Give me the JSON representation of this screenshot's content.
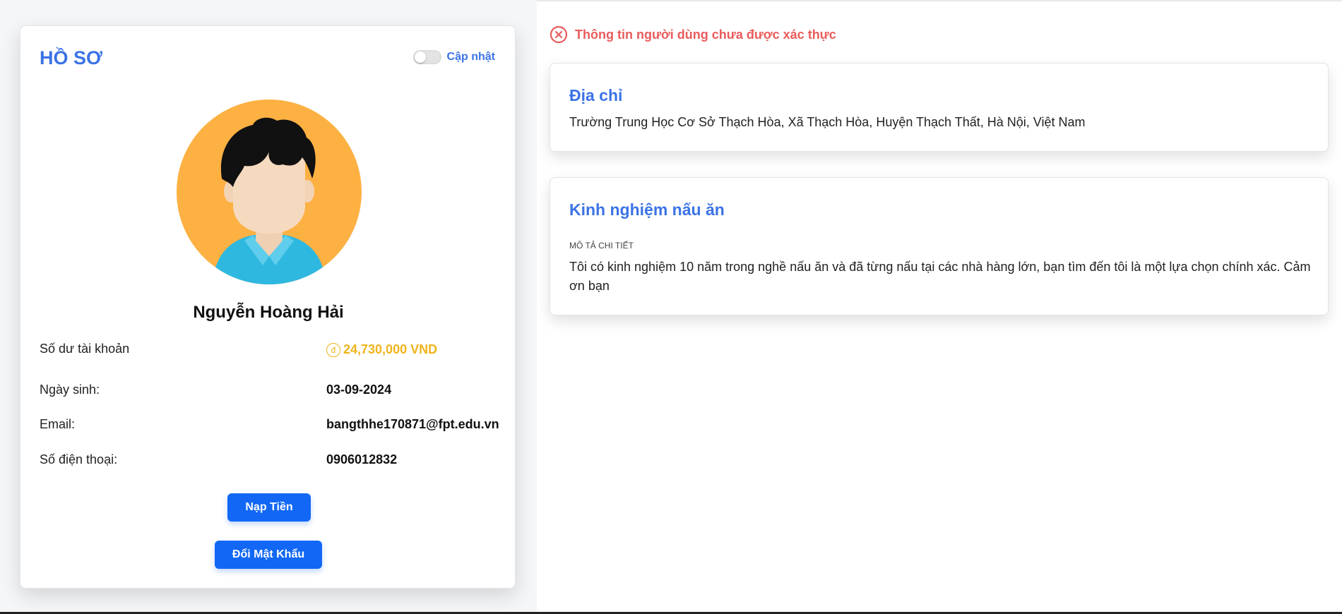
{
  "profile": {
    "title": "HỒ SƠ",
    "toggle_label": "Cập nhật",
    "name": "Nguyễn Hoàng Hải",
    "fields": {
      "balance_label": "Số dư tài khoản",
      "balance_currency_symbol": "đ",
      "balance_value": "24,730,000 VND",
      "dob_label": "Ngày sinh:",
      "dob_value": "03-09-2024",
      "email_label": "Email:",
      "email_value": "bangthhe170871@fpt.edu.vn",
      "phone_label": "Số điện thoại:",
      "phone_value": "0906012832"
    },
    "buttons": {
      "deposit": "Nạp Tiền",
      "change_password": "Đổi Mật Khẩu"
    }
  },
  "alert": {
    "text": "Thông tin người dùng chưa được xác thực",
    "icon": "close-circle-icon"
  },
  "address_card": {
    "title": "Địa chỉ",
    "text": "Trường Trung Học Cơ Sở Thạch Hòa, Xã Thạch Hòa, Huyện Thạch Thất, Hà Nội, Việt Nam"
  },
  "experience_card": {
    "title": "Kinh nghiệm nấu ăn",
    "caption": "MÔ TẢ CHI TIẾT",
    "text": "Tôi có kinh nghiệm 10 năm trong nghề nấu ăn và đã từng nấu tại các nhà hàng lớn, bạn tìm đến tôi là một lựa chọn chính xác. Cảm ơn bạn"
  },
  "colors": {
    "accent": "#3b73e6",
    "button": "#1268f5",
    "alert": "#e95b5b",
    "balance": "#f0b41c",
    "avatar_bg": "#fdb143"
  }
}
